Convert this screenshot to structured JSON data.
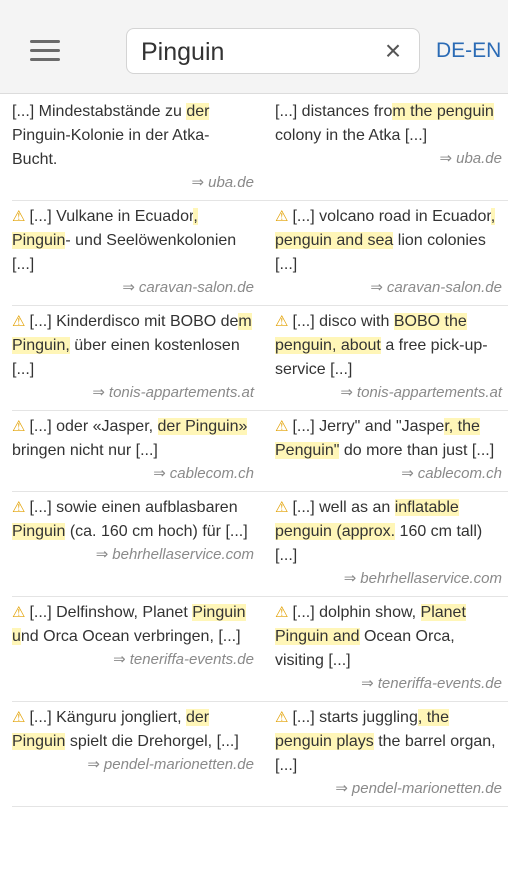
{
  "header": {
    "search_value": "Pinguin",
    "search_placeholder": "",
    "clear_icon": "×",
    "lang_label": "DE-EN",
    "menu_icon": "hamburger-menu-icon"
  },
  "source_arrow": "⇒",
  "warning_icon": "⚠",
  "rows": [
    {
      "left": {
        "parts": [
          "[...] Mindestabstände zu ",
          "der",
          " ",
          "Pinguin",
          "-Kolonie in der Atka-Bucht."
        ],
        "source": "uba.de"
      },
      "right": {
        "parts": [
          "[...] distances fro",
          "m the penguin",
          " colony in the Atka [...]"
        ],
        "source": "uba.de"
      }
    },
    {
      "left": {
        "parts": [
          "[...] Vulkane in Ecuador",
          ", Pinguin",
          "- und Seelöwenkolonien [...]"
        ],
        "source": "caravan-salon.de"
      },
      "right": {
        "parts": [
          "[...] volcano road in Ecuador",
          ", penguin and sea",
          " lion colonies [...]"
        ],
        "source": "caravan-salon.de"
      }
    },
    {
      "left": {
        "parts": [
          "[...] Kinderdisco mit BOBO de",
          "m Pinguin,",
          " über einen kostenlosen [...]"
        ],
        "source": "tonis-appartements.at"
      },
      "right": {
        "parts": [
          "[...] disco with ",
          "BOBO the penguin, about",
          " a free pick-up-service [...]"
        ],
        "source": "tonis-appartements.at"
      }
    },
    {
      "left": {
        "parts": [
          "[...] oder «Jasper, ",
          "der Pinguin»",
          " bringen nicht nur [...]"
        ],
        "source": "cablecom.ch"
      },
      "right": {
        "parts": [
          "[...] Jerry\" and \"Jaspe",
          "r, the Penguin\"",
          " do more than just [...]"
        ],
        "source": "cablecom.ch"
      }
    },
    {
      "left": {
        "parts": [
          "[...] sowie einen aufblasbaren ",
          "Pinguin",
          " (ca. 160 cm hoch) für [...]"
        ],
        "source": "behrhellaservice.com"
      },
      "right": {
        "parts": [
          "[...] well as an ",
          "inflatable penguin (approx.",
          " 160 cm tall) [...]"
        ],
        "source": "behrhellaservice.com"
      }
    },
    {
      "left": {
        "parts": [
          "[...] Delfinshow, Planet ",
          "Pinguin u",
          "nd Orca Ocean verbringen, [...]"
        ],
        "source": "teneriffa-events.de"
      },
      "right": {
        "parts": [
          "[...] dolphin show, ",
          "Planet Pinguin and",
          " Ocean Orca, visiting [...]"
        ],
        "source": "teneriffa-events.de"
      }
    },
    {
      "left": {
        "parts": [
          "[...] Känguru jongliert, ",
          "der Pinguin",
          " spielt die Drehorgel, [...]"
        ],
        "source": "pendel-marionetten.de"
      },
      "right": {
        "parts": [
          "[...] starts juggling",
          ", the penguin plays",
          " the barrel organ, [...]"
        ],
        "source": "pendel-marionetten.de"
      }
    }
  ]
}
